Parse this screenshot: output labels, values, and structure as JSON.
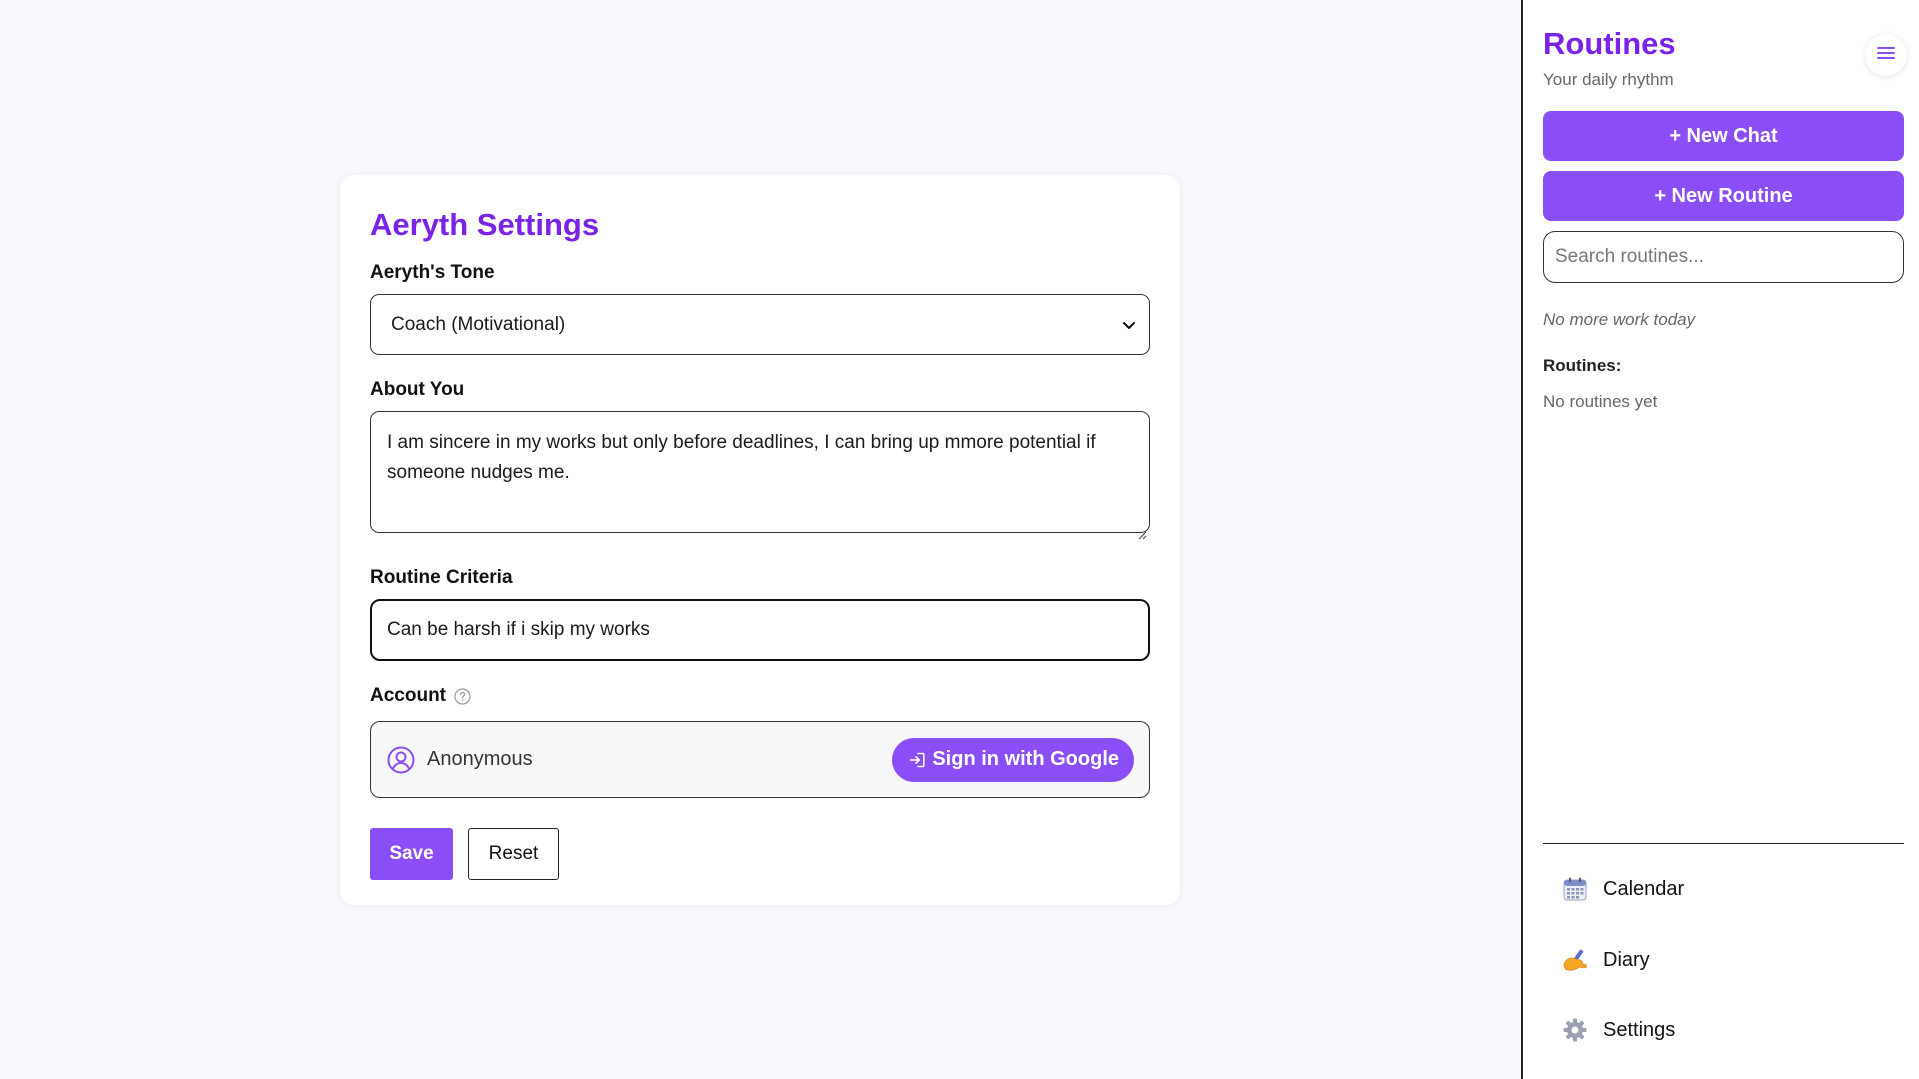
{
  "settings": {
    "title": "Aeryth Settings",
    "tone_label": "Aeryth's Tone",
    "tone_value": "Coach (Motivational)",
    "about_label": "About You",
    "about_value": "I am sincere in my works but only before deadlines, I can bring up mmore potential if someone nudges me.",
    "criteria_label": "Routine Criteria",
    "criteria_value": "Can be harsh if i skip my works",
    "account_label": "Account",
    "account_user": "Anonymous",
    "signin_label": "Sign in with Google",
    "save_label": "Save",
    "reset_label": "Reset"
  },
  "sidebar": {
    "title": "Routines",
    "subtitle": "Your daily rhythm",
    "new_chat_label": "+ New Chat",
    "new_routine_label": "+ New Routine",
    "search_placeholder": "Search routines...",
    "status_text": "No more work today",
    "routines_label": "Routines:",
    "routines_empty": "No routines yet",
    "nav": [
      {
        "label": "Calendar",
        "icon": "calendar-icon"
      },
      {
        "label": "Diary",
        "icon": "writing-hand-icon"
      },
      {
        "label": "Settings",
        "icon": "gear-icon"
      }
    ]
  },
  "colors": {
    "accent": "#8b4df5",
    "title": "#7a22e6",
    "background": "#faf7fd"
  }
}
